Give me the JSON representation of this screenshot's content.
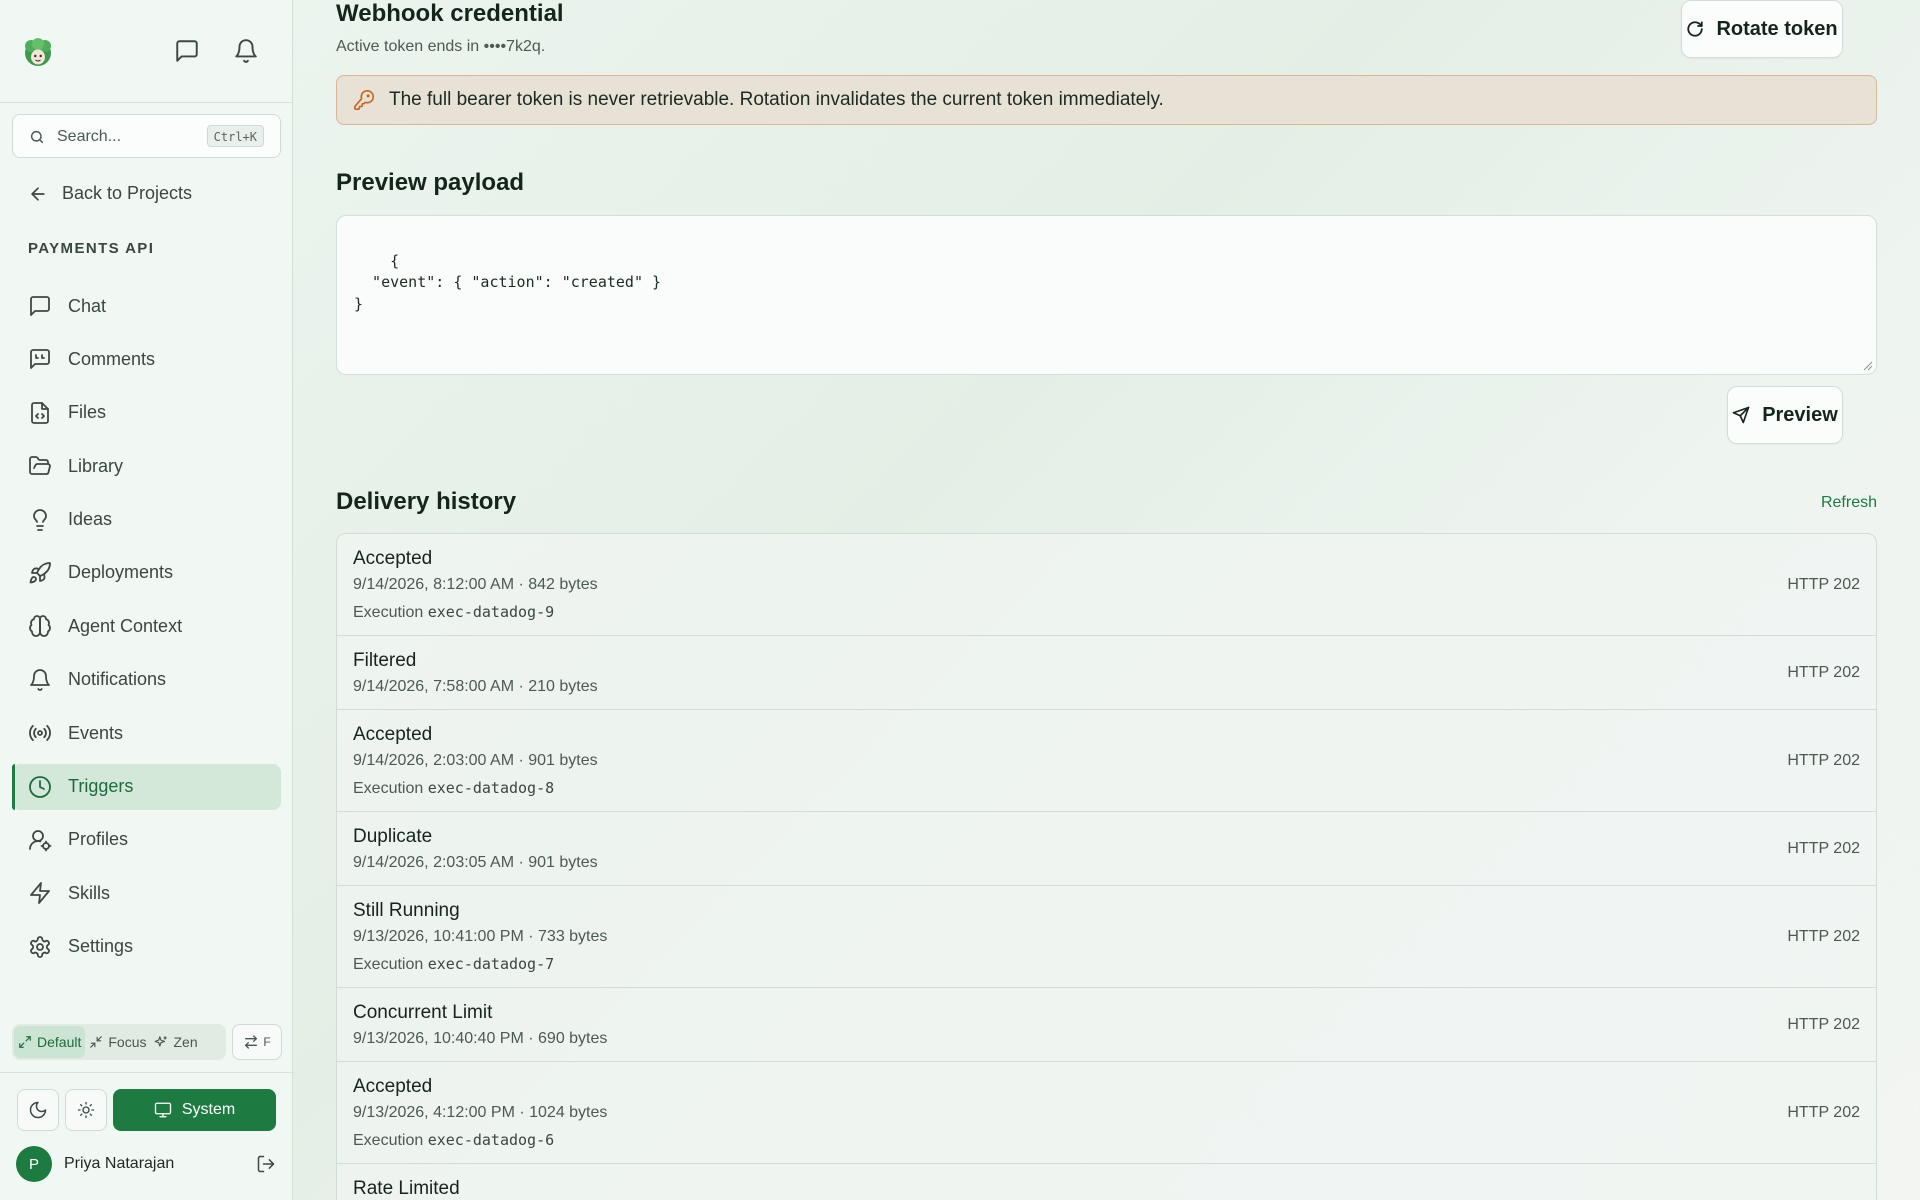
{
  "sidebar": {
    "search": {
      "placeholder": "Search...",
      "shortcut": "Ctrl+K"
    },
    "back_label": "Back to Projects",
    "project_name": "PAYMENTS API",
    "items": [
      {
        "label": "Chat",
        "icon": "chat-icon"
      },
      {
        "label": "Comments",
        "icon": "comments-icon"
      },
      {
        "label": "Files",
        "icon": "file-code-icon"
      },
      {
        "label": "Library",
        "icon": "folder-open-icon"
      },
      {
        "label": "Ideas",
        "icon": "lightbulb-icon"
      },
      {
        "label": "Deployments",
        "icon": "rocket-icon"
      },
      {
        "label": "Agent Context",
        "icon": "brain-icon"
      },
      {
        "label": "Notifications",
        "icon": "bell-icon"
      },
      {
        "label": "Events",
        "icon": "broadcast-icon"
      },
      {
        "label": "Triggers",
        "icon": "clock-icon",
        "active": true
      },
      {
        "label": "Profiles",
        "icon": "user-gear-icon"
      },
      {
        "label": "Skills",
        "icon": "bolt-icon"
      },
      {
        "label": "Settings",
        "icon": "gear-icon"
      }
    ],
    "modes": {
      "default": "Default",
      "focus": "Focus",
      "zen": "Zen",
      "active": "Default"
    },
    "swap_shortcut": "F",
    "theme": {
      "system_label": "System",
      "selected": "System"
    },
    "user": {
      "name": "Priya Natarajan",
      "initial": "P"
    }
  },
  "credential": {
    "title": "Webhook credential",
    "subtitle": "Active token ends in ••••7k2q.",
    "rotate_label": "Rotate token",
    "warning": "The full bearer token is never retrievable. Rotation invalidates the current token immediately."
  },
  "preview": {
    "title": "Preview payload",
    "payload": "{\n  \"event\": { \"action\": \"created\" }\n}",
    "button_label": "Preview"
  },
  "history": {
    "title": "Delivery history",
    "refresh_label": "Refresh",
    "rows": [
      {
        "status": "Accepted",
        "meta": "9/14/2026, 8:12:00 AM · 842 bytes",
        "exec_prefix": "Execution ",
        "exec_id": "exec-datadog-9",
        "http": "HTTP 202"
      },
      {
        "status": "Filtered",
        "meta": "9/14/2026, 7:58:00 AM · 210 bytes",
        "http": "HTTP 202"
      },
      {
        "status": "Accepted",
        "meta": "9/14/2026, 2:03:00 AM · 901 bytes",
        "exec_prefix": "Execution ",
        "exec_id": "exec-datadog-8",
        "http": "HTTP 202"
      },
      {
        "status": "Duplicate",
        "meta": "9/14/2026, 2:03:05 AM · 901 bytes",
        "http": "HTTP 202"
      },
      {
        "status": "Still Running",
        "meta": "9/13/2026, 10:41:00 PM · 733 bytes",
        "exec_prefix": "Execution ",
        "exec_id": "exec-datadog-7",
        "http": "HTTP 202"
      },
      {
        "status": "Concurrent Limit",
        "meta": "9/13/2026, 10:40:40 PM · 690 bytes",
        "http": "HTTP 202"
      },
      {
        "status": "Accepted",
        "meta": "9/13/2026, 4:12:00 PM · 1024 bytes",
        "exec_prefix": "Execution ",
        "exec_id": "exec-datadog-6",
        "http": "HTTP 202"
      },
      {
        "status": "Rate Limited"
      }
    ]
  },
  "colors": {
    "accent": "#1d7a41",
    "active_nav_bg": "#d3e8d9",
    "warning_border": "#d9b795",
    "warning_bg": "#e8e1d6",
    "warning_icon": "#c4681f"
  }
}
